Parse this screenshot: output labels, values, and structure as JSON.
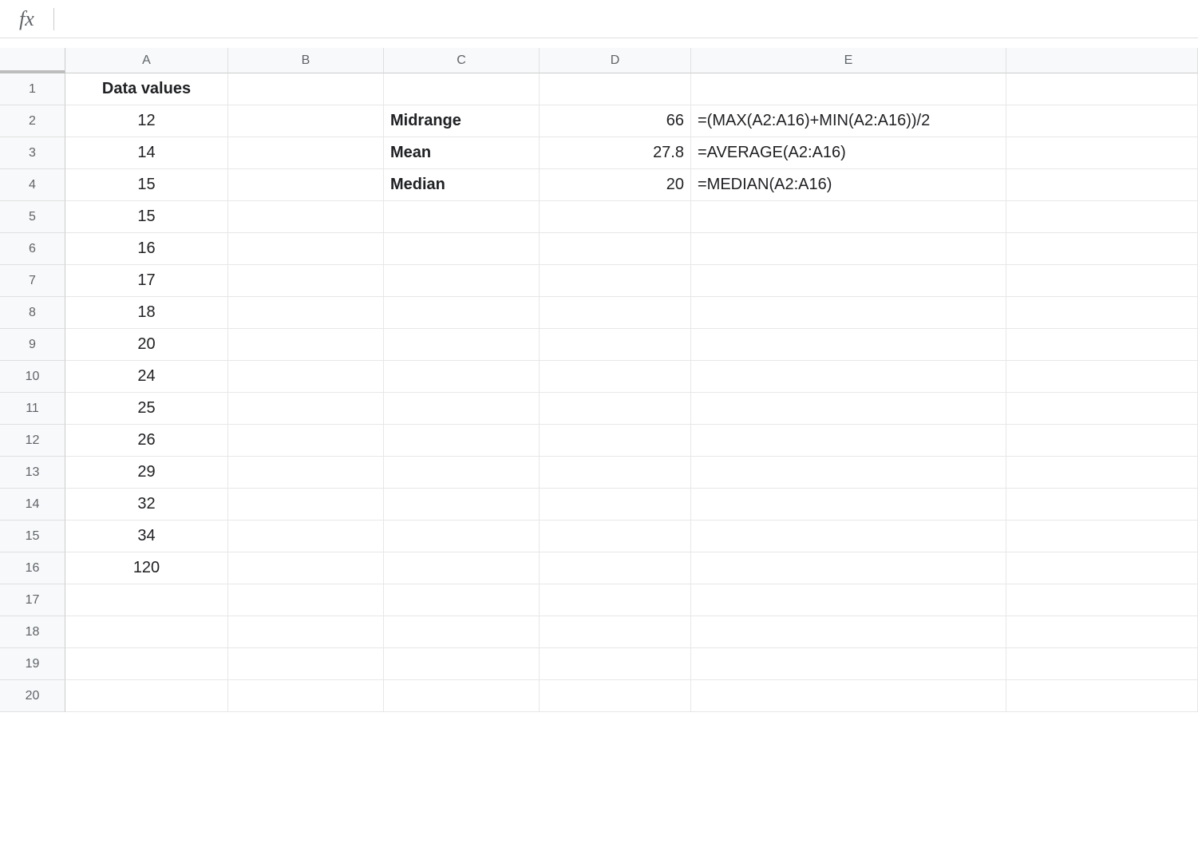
{
  "formula_bar": {
    "fx_label": "fx",
    "value": ""
  },
  "columns": [
    "A",
    "B",
    "C",
    "D",
    "E"
  ],
  "row_count": 20,
  "cells": {
    "A1": {
      "text": "Data values",
      "bold": true,
      "align": "center"
    },
    "A2": {
      "text": "12",
      "align": "center"
    },
    "A3": {
      "text": "14",
      "align": "center"
    },
    "A4": {
      "text": "15",
      "align": "center"
    },
    "A5": {
      "text": "15",
      "align": "center"
    },
    "A6": {
      "text": "16",
      "align": "center"
    },
    "A7": {
      "text": "17",
      "align": "center"
    },
    "A8": {
      "text": "18",
      "align": "center"
    },
    "A9": {
      "text": "20",
      "align": "center"
    },
    "A10": {
      "text": "24",
      "align": "center"
    },
    "A11": {
      "text": "25",
      "align": "center"
    },
    "A12": {
      "text": "26",
      "align": "center"
    },
    "A13": {
      "text": "29",
      "align": "center"
    },
    "A14": {
      "text": "32",
      "align": "center"
    },
    "A15": {
      "text": "34",
      "align": "center"
    },
    "A16": {
      "text": "120",
      "align": "center"
    },
    "C2": {
      "text": "Midrange",
      "bold": true,
      "align": "left"
    },
    "C3": {
      "text": "Mean",
      "bold": true,
      "align": "left"
    },
    "C4": {
      "text": "Median",
      "bold": true,
      "align": "left"
    },
    "D2": {
      "text": "66",
      "align": "right"
    },
    "D3": {
      "text": "27.8",
      "align": "right"
    },
    "D4": {
      "text": "20",
      "align": "right"
    },
    "E2": {
      "text": "=(MAX(A2:A16)+MIN(A2:A16))/2",
      "align": "left"
    },
    "E3": {
      "text": "=AVERAGE(A2:A16)",
      "align": "left"
    },
    "E4": {
      "text": "=MEDIAN(A2:A16)",
      "align": "left"
    }
  }
}
